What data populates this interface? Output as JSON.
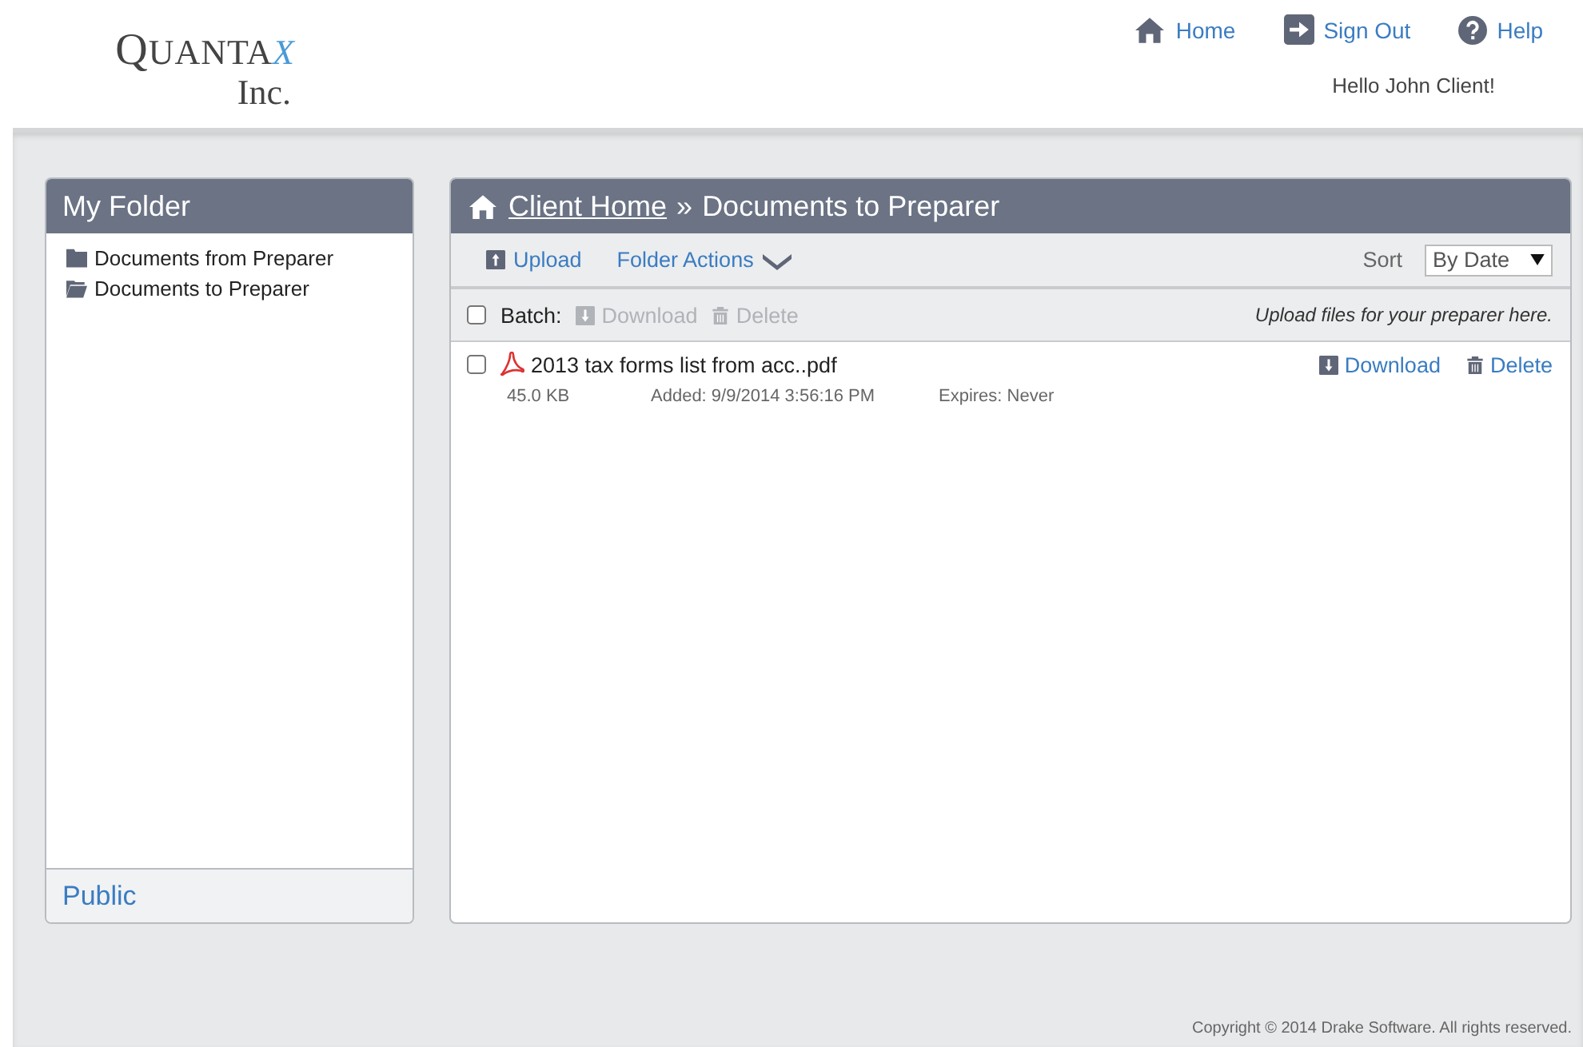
{
  "logo": {
    "name": "QUANTA",
    "mark": "X",
    "sub": "Inc."
  },
  "nav": [
    {
      "kind": "home",
      "label": "Home"
    },
    {
      "kind": "signout",
      "label": "Sign Out"
    },
    {
      "kind": "help",
      "label": "Help"
    }
  ],
  "greeting": "Hello John Client!",
  "sidebar": {
    "title": "My Folder",
    "items": [
      {
        "label": "Documents from Preparer",
        "selected": false
      },
      {
        "label": "Documents to Preparer",
        "selected": true
      }
    ],
    "footer": "Public"
  },
  "main": {
    "breadcrumb": {
      "link": "Client Home",
      "separator": "»",
      "current": "Documents to Preparer"
    },
    "toolbar": {
      "upload": "Upload",
      "folder_actions": "Folder Actions",
      "sort_label": "Sort",
      "sort_value": "By Date"
    },
    "batch": {
      "label": "Batch:",
      "checked": false,
      "disabled": true,
      "download": "Download",
      "delete": "Delete",
      "hint": "Upload files for your preparer here."
    },
    "files": [
      {
        "name": "2013 tax forms list from acc..pdf",
        "checked": false,
        "size": "45.0 KB",
        "added": "Added: 9/9/2014 3:56:16 PM",
        "expires": "Expires: Never",
        "download": "Download",
        "delete": "Delete"
      }
    ]
  },
  "footer": "Copyright © 2014 Drake Software. All rights reserved."
}
